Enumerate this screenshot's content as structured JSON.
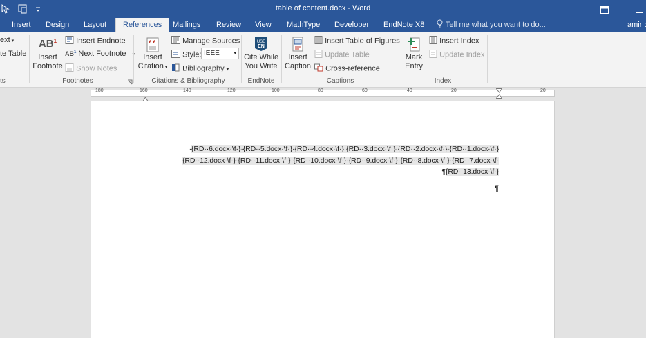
{
  "window": {
    "title": "table of content.docx - Word"
  },
  "tabs": [
    {
      "label": "Insert"
    },
    {
      "label": "Design"
    },
    {
      "label": "Layout"
    },
    {
      "label": "References"
    },
    {
      "label": "Mailings"
    },
    {
      "label": "Review"
    },
    {
      "label": "View"
    },
    {
      "label": "MathType"
    },
    {
      "label": "Developer"
    },
    {
      "label": "EndNote X8"
    }
  ],
  "tell_me": "Tell me what you want to do...",
  "user": "amir c",
  "ribbon": {
    "toc": {
      "partial1": "ext",
      "partial2": "te Table",
      "group_partial": "ts"
    },
    "footnotes": {
      "insert_footnote": [
        "Insert",
        "Footnote"
      ],
      "insert_endnote": "Insert Endnote",
      "next_footnote": "Next Footnote",
      "show_notes": "Show Notes",
      "group": "Footnotes"
    },
    "citations": {
      "insert_citation": [
        "Insert",
        "Citation"
      ],
      "manage_sources": "Manage Sources",
      "style_label": "Style:",
      "style_value": "IEEE",
      "bibliography": "Bibliography",
      "group": "Citations & Bibliography"
    },
    "endnote": {
      "cite_while": [
        "Cite While",
        "You Write"
      ],
      "group": "EndNote"
    },
    "captions": {
      "insert_caption": [
        "Insert",
        "Caption"
      ],
      "insert_tof": "Insert Table of Figures",
      "update_table": "Update Table",
      "cross_reference": "Cross-reference",
      "group": "Captions"
    },
    "index": {
      "mark_entry": [
        "Mark",
        "Entry"
      ],
      "insert_index": "Insert Index",
      "update_index": "Update Index",
      "group": "Index"
    }
  },
  "ruler": {
    "labels": [
      "180",
      "160",
      "140",
      "120",
      "100",
      "80",
      "60",
      "40",
      "20",
      "20"
    ]
  },
  "document": {
    "lines": [
      {
        "prefix": "·",
        "text": "{RD··6.docx·\\f·}·{RD··5.docx·\\f·}·{RD··4.docx·\\f·}·{RD··3.docx·\\f·}·{RD··2.docx·\\f·}·{RD··1.docx·\\f·}"
      },
      {
        "prefix": "",
        "text": "{RD··12.docx·\\f·}·{RD··11.docx·\\f·}·{RD··10.docx·\\f·}·{RD··9.docx·\\f·}·{RD··8.docx·\\f·}·{RD··7.docx·\\f·"
      },
      {
        "prefix": "¶",
        "text": "{RD··13.docx·\\f·}"
      }
    ],
    "para_mark": "¶"
  }
}
